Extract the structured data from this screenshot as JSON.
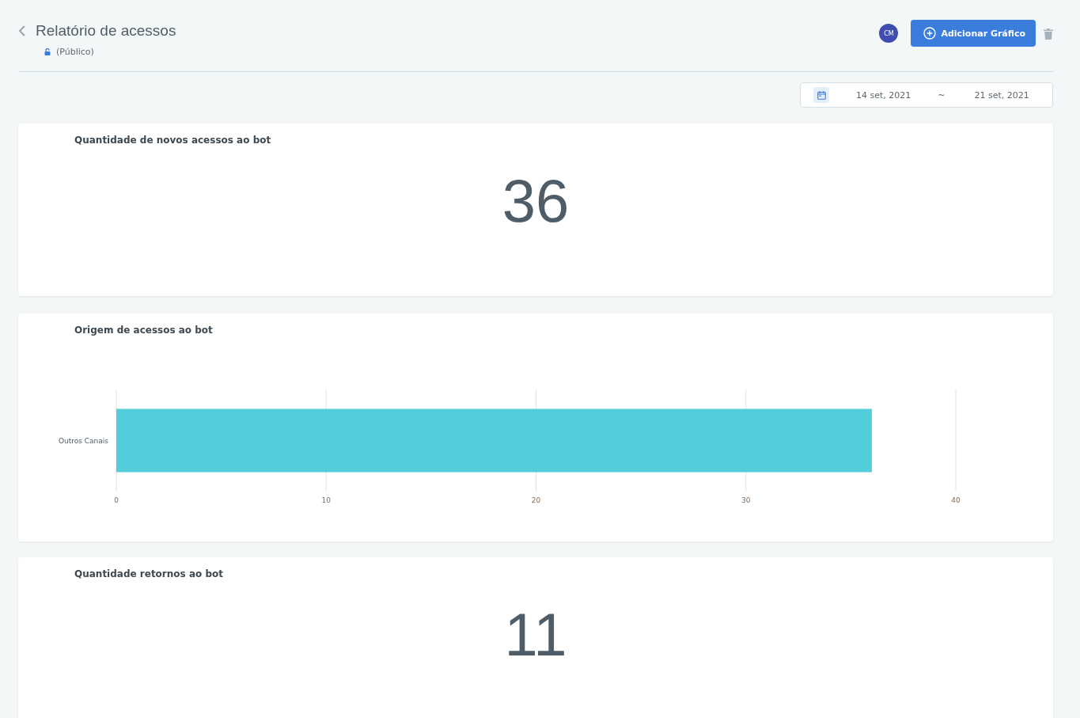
{
  "header": {
    "title": "Relatório de acessos",
    "visibility": "(Público)",
    "avatar": "CM",
    "add_button": "Adicionar Gráfico"
  },
  "date_range": {
    "start": "14 set, 2021",
    "separator": "~",
    "end": "21 set, 2021"
  },
  "cards": [
    {
      "kind": "number",
      "title": "Quantidade de novos acessos ao bot",
      "value": "36"
    },
    {
      "kind": "chart",
      "title": "Origem de acessos ao bot",
      "chart_data": {
        "type": "bar",
        "orientation": "horizontal",
        "categories": [
          "Outros Canais"
        ],
        "series": [
          {
            "color": "#53cdda",
            "values": [
              36
            ]
          }
        ],
        "xlim": [
          0,
          40
        ],
        "xticks": [
          0,
          10,
          20,
          30,
          40
        ],
        "grid": true
      }
    },
    {
      "kind": "number",
      "title": "Quantidade retornos ao bot",
      "value": "11"
    }
  ]
}
